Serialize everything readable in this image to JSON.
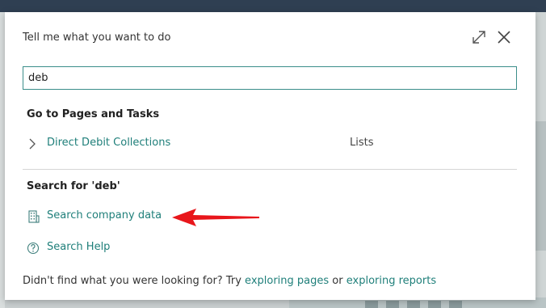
{
  "dialog": {
    "title": "Tell me what you want to do",
    "search": {
      "value": "deb"
    },
    "pages_section": {
      "heading": "Go to Pages and Tasks",
      "results": [
        {
          "label": "Direct Debit Collections",
          "category": "Lists"
        }
      ]
    },
    "search_section": {
      "heading": "Search for 'deb'",
      "actions": [
        {
          "label": "Search company data",
          "icon": "building-icon"
        },
        {
          "label": "Search Help",
          "icon": "help-circle-icon"
        }
      ]
    },
    "footer": {
      "prefix": "Didn't find what you were looking for? Try",
      "link1": "exploring pages",
      "middle": "or",
      "link2": "exploring reports"
    }
  },
  "colors": {
    "accent": "#1f7f7a",
    "topbar": "#2f3f52",
    "annotation_arrow": "#e8161b"
  }
}
